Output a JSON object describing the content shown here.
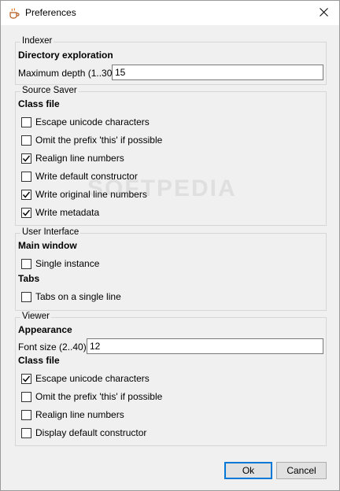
{
  "window": {
    "title": "Preferences"
  },
  "indexer": {
    "group_title": "Indexer",
    "section": "Directory exploration",
    "max_depth_label": "Maximum depth (1..30):",
    "max_depth_value": "15"
  },
  "source_saver": {
    "group_title": "Source Saver",
    "section": "Class file",
    "options": [
      {
        "label": "Escape unicode characters",
        "checked": false
      },
      {
        "label": "Omit the prefix 'this' if possible",
        "checked": false
      },
      {
        "label": "Realign line numbers",
        "checked": true
      },
      {
        "label": "Write default constructor",
        "checked": false
      },
      {
        "label": "Write original line numbers",
        "checked": true
      },
      {
        "label": "Write metadata",
        "checked": true
      }
    ]
  },
  "user_interface": {
    "group_title": "User Interface",
    "main_window_section": "Main window",
    "single_instance": {
      "label": "Single instance",
      "checked": false
    },
    "tabs_section": "Tabs",
    "tabs_single_line": {
      "label": "Tabs on a single line",
      "checked": false
    }
  },
  "viewer": {
    "group_title": "Viewer",
    "appearance_section": "Appearance",
    "font_size_label": "Font size (2..40):",
    "font_size_value": "12",
    "class_file_section": "Class file",
    "options": [
      {
        "label": "Escape unicode characters",
        "checked": true
      },
      {
        "label": "Omit the prefix 'this' if possible",
        "checked": false
      },
      {
        "label": "Realign line numbers",
        "checked": false
      },
      {
        "label": "Display default constructor",
        "checked": false
      }
    ]
  },
  "buttons": {
    "ok": "Ok",
    "cancel": "Cancel"
  },
  "watermark": "SOFTPEDIA"
}
